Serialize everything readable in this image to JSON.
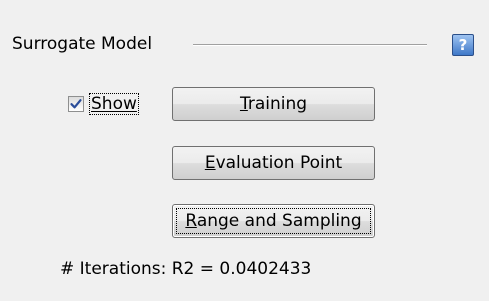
{
  "group": {
    "title": "Surrogate Model",
    "help_label": "?"
  },
  "show_checkbox": {
    "label": "Show",
    "checked": true
  },
  "buttons": {
    "training": {
      "mnemonic": "T",
      "rest": "raining"
    },
    "evaluation_point": {
      "mnemonic": "E",
      "rest": "valuation Point"
    },
    "range_sampling": {
      "mnemonic": "R",
      "rest": "ange and Sampling"
    }
  },
  "status": {
    "text": "# Iterations: R2 = 0.0402433"
  }
}
